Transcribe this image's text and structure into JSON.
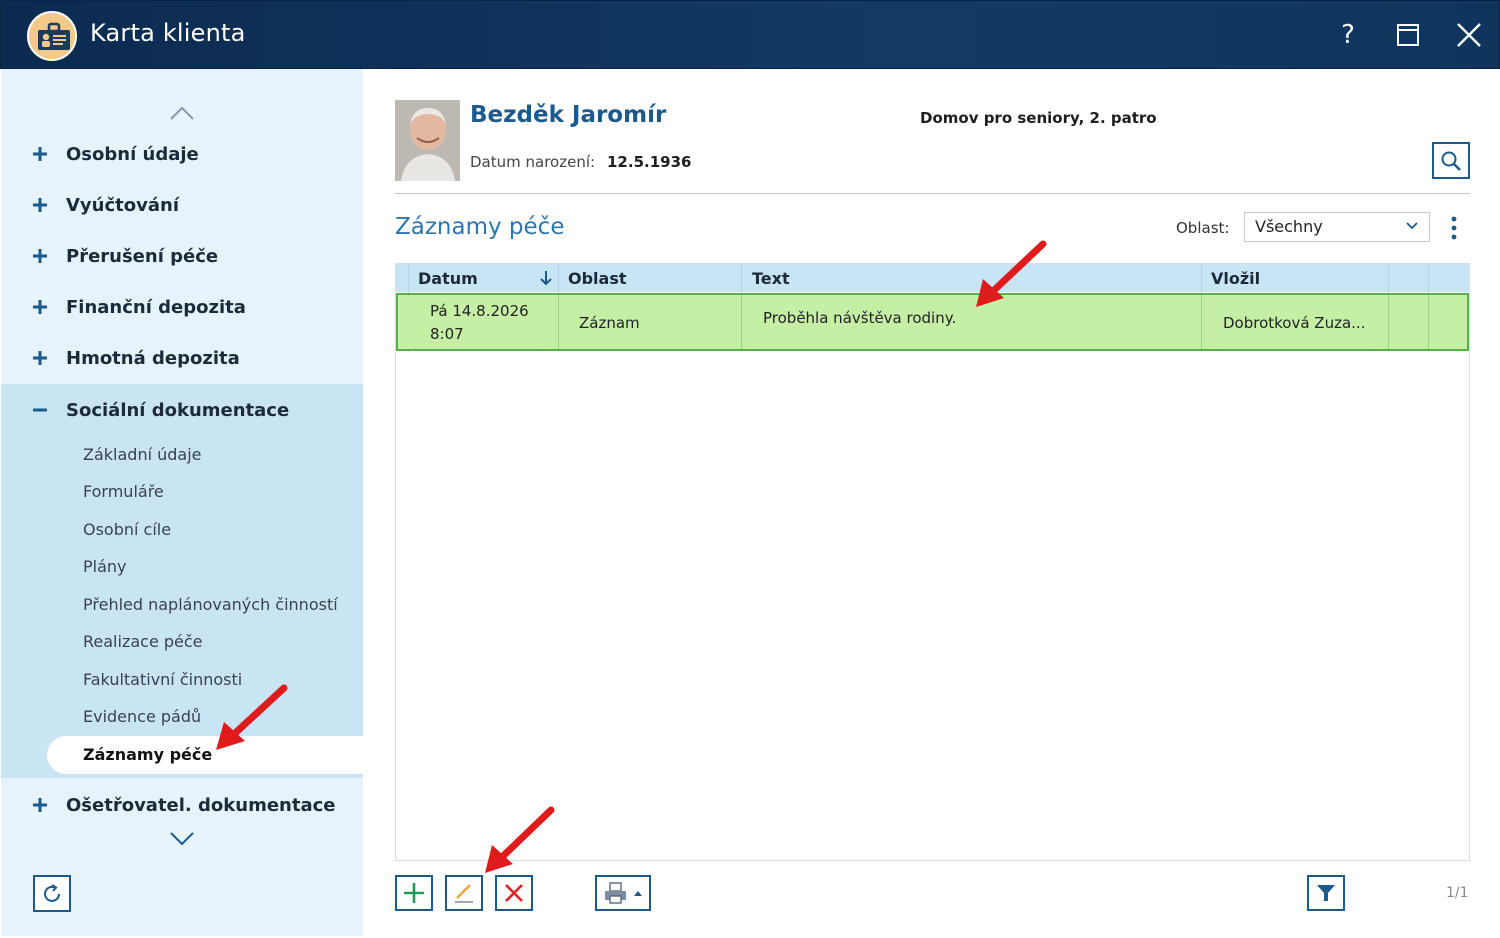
{
  "window": {
    "title": "Karta klienta",
    "help_label": "?",
    "controls": [
      "help-icon",
      "maximize-icon",
      "close-icon"
    ]
  },
  "sidebar": {
    "items": [
      {
        "label": "Osobní údaje",
        "icon": "plus-icon"
      },
      {
        "label": "Vyúčtování",
        "icon": "plus-icon"
      },
      {
        "label": "Přerušení péče",
        "icon": "plus-icon"
      },
      {
        "label": "Finanční depozita",
        "icon": "plus-icon"
      },
      {
        "label": "Hmotná depozita",
        "icon": "plus-icon"
      },
      {
        "label": "Sociální dokumentace",
        "icon": "minus-icon"
      },
      {
        "label": "Ošetřovatel. dokumentace",
        "icon": "plus-icon"
      }
    ],
    "subitems": [
      "Základní údaje",
      "Formuláře",
      "Osobní cíle",
      "Plány",
      "Přehled naplánovaných činností",
      "Realizace péče",
      "Fakultativní činnosti",
      "Evidence pádů",
      "Záznamy péče"
    ],
    "active_subitem": "Záznamy péče"
  },
  "client": {
    "name": "Bezděk Jaromír",
    "dob_label": "Datum narození:",
    "dob_value": "12.5.1936",
    "facility": "Domov pro seniory, 2. patro"
  },
  "section": {
    "title": "Záznamy péče",
    "area_label": "Oblast:",
    "area_value": "Všechny"
  },
  "table": {
    "columns": [
      "Datum",
      "Oblast",
      "Text",
      "Vložil"
    ],
    "sort_column": "Datum",
    "rows": [
      {
        "date_line1": "Pá 14.8.2026",
        "date_line2": "8:07",
        "area": "Záznam",
        "text": "Proběhla návštěva rodiny.",
        "author": "Dobrotková Zuza..."
      }
    ]
  },
  "pager": {
    "text": "1/1"
  },
  "colors": {
    "titlebar": "#0c2a4f",
    "accent": "#1b5a8c",
    "sidebar_bg": "#e6f3fb",
    "selected_row": "#c6efa6",
    "annotation_arrow": "#e01b1b"
  }
}
